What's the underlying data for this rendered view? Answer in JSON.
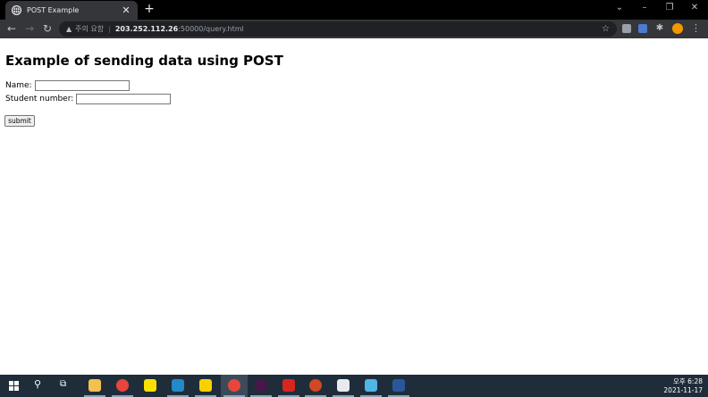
{
  "tab": {
    "title": "POST Example"
  },
  "address": {
    "warning_text": "주의 요함",
    "host": "203.252.112.26",
    "path": ":50000/query.html"
  },
  "page": {
    "heading": "Example of sending data using POST",
    "name_label": "Name:",
    "student_label": "Student number:",
    "submit_label": "submit"
  },
  "taskbar": {
    "time": "오후 6:28",
    "date": "2021-11-17"
  }
}
